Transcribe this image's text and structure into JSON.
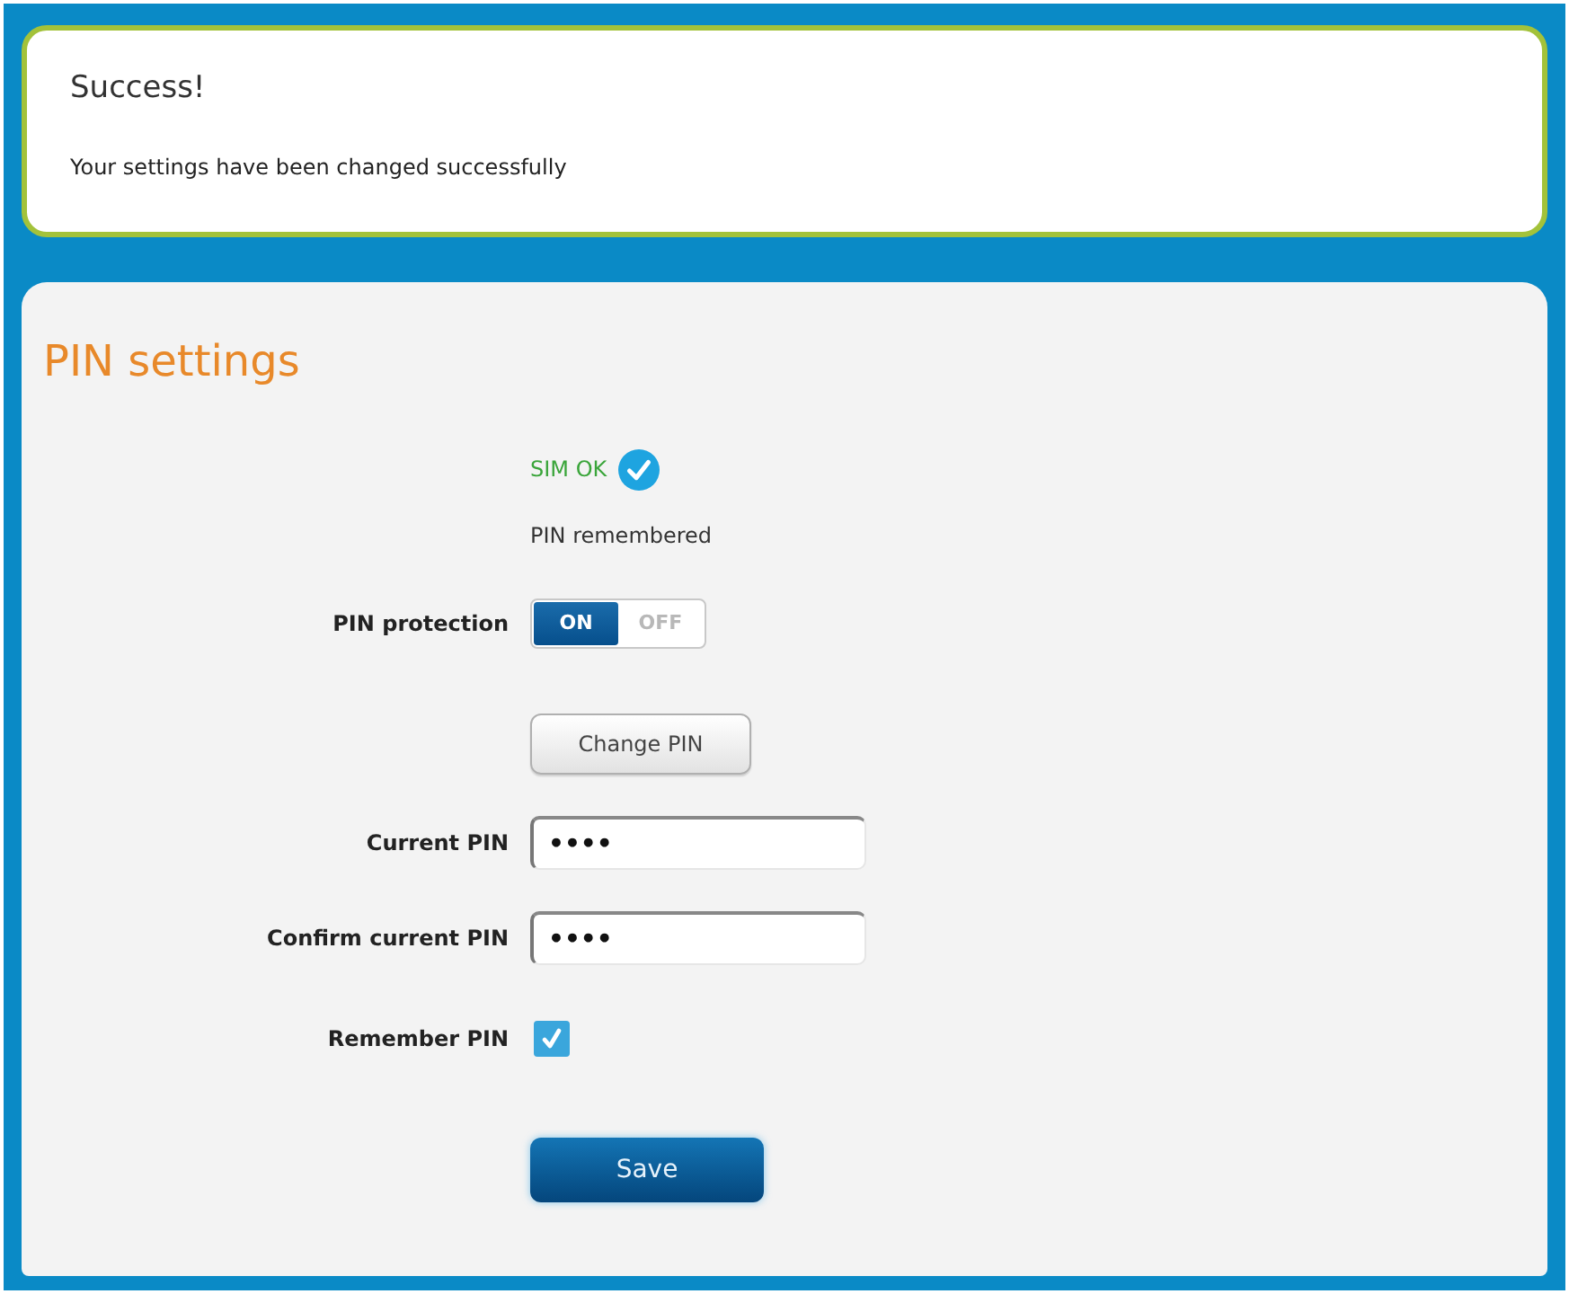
{
  "alert": {
    "title": "Success!",
    "message": "Your settings have been changed successfully"
  },
  "panel": {
    "title": "PIN settings",
    "rows": [
      {
        "kind": "status",
        "text": "SIM OK"
      },
      {
        "kind": "note",
        "text": "PIN remembered"
      },
      {
        "kind": "toggle",
        "label": "PIN protection",
        "options": [
          {
            "label": "ON",
            "selected": true
          },
          {
            "label": "OFF",
            "selected": false
          }
        ]
      },
      {
        "kind": "button",
        "text": "Change PIN"
      },
      {
        "kind": "password",
        "label": "Current PIN",
        "value": "••••"
      },
      {
        "kind": "password",
        "label": "Confirm current PIN",
        "value": "••••"
      },
      {
        "kind": "checkbox",
        "label": "Remember PIN",
        "checked": true
      },
      {
        "kind": "submit",
        "text": "Save"
      }
    ]
  }
}
